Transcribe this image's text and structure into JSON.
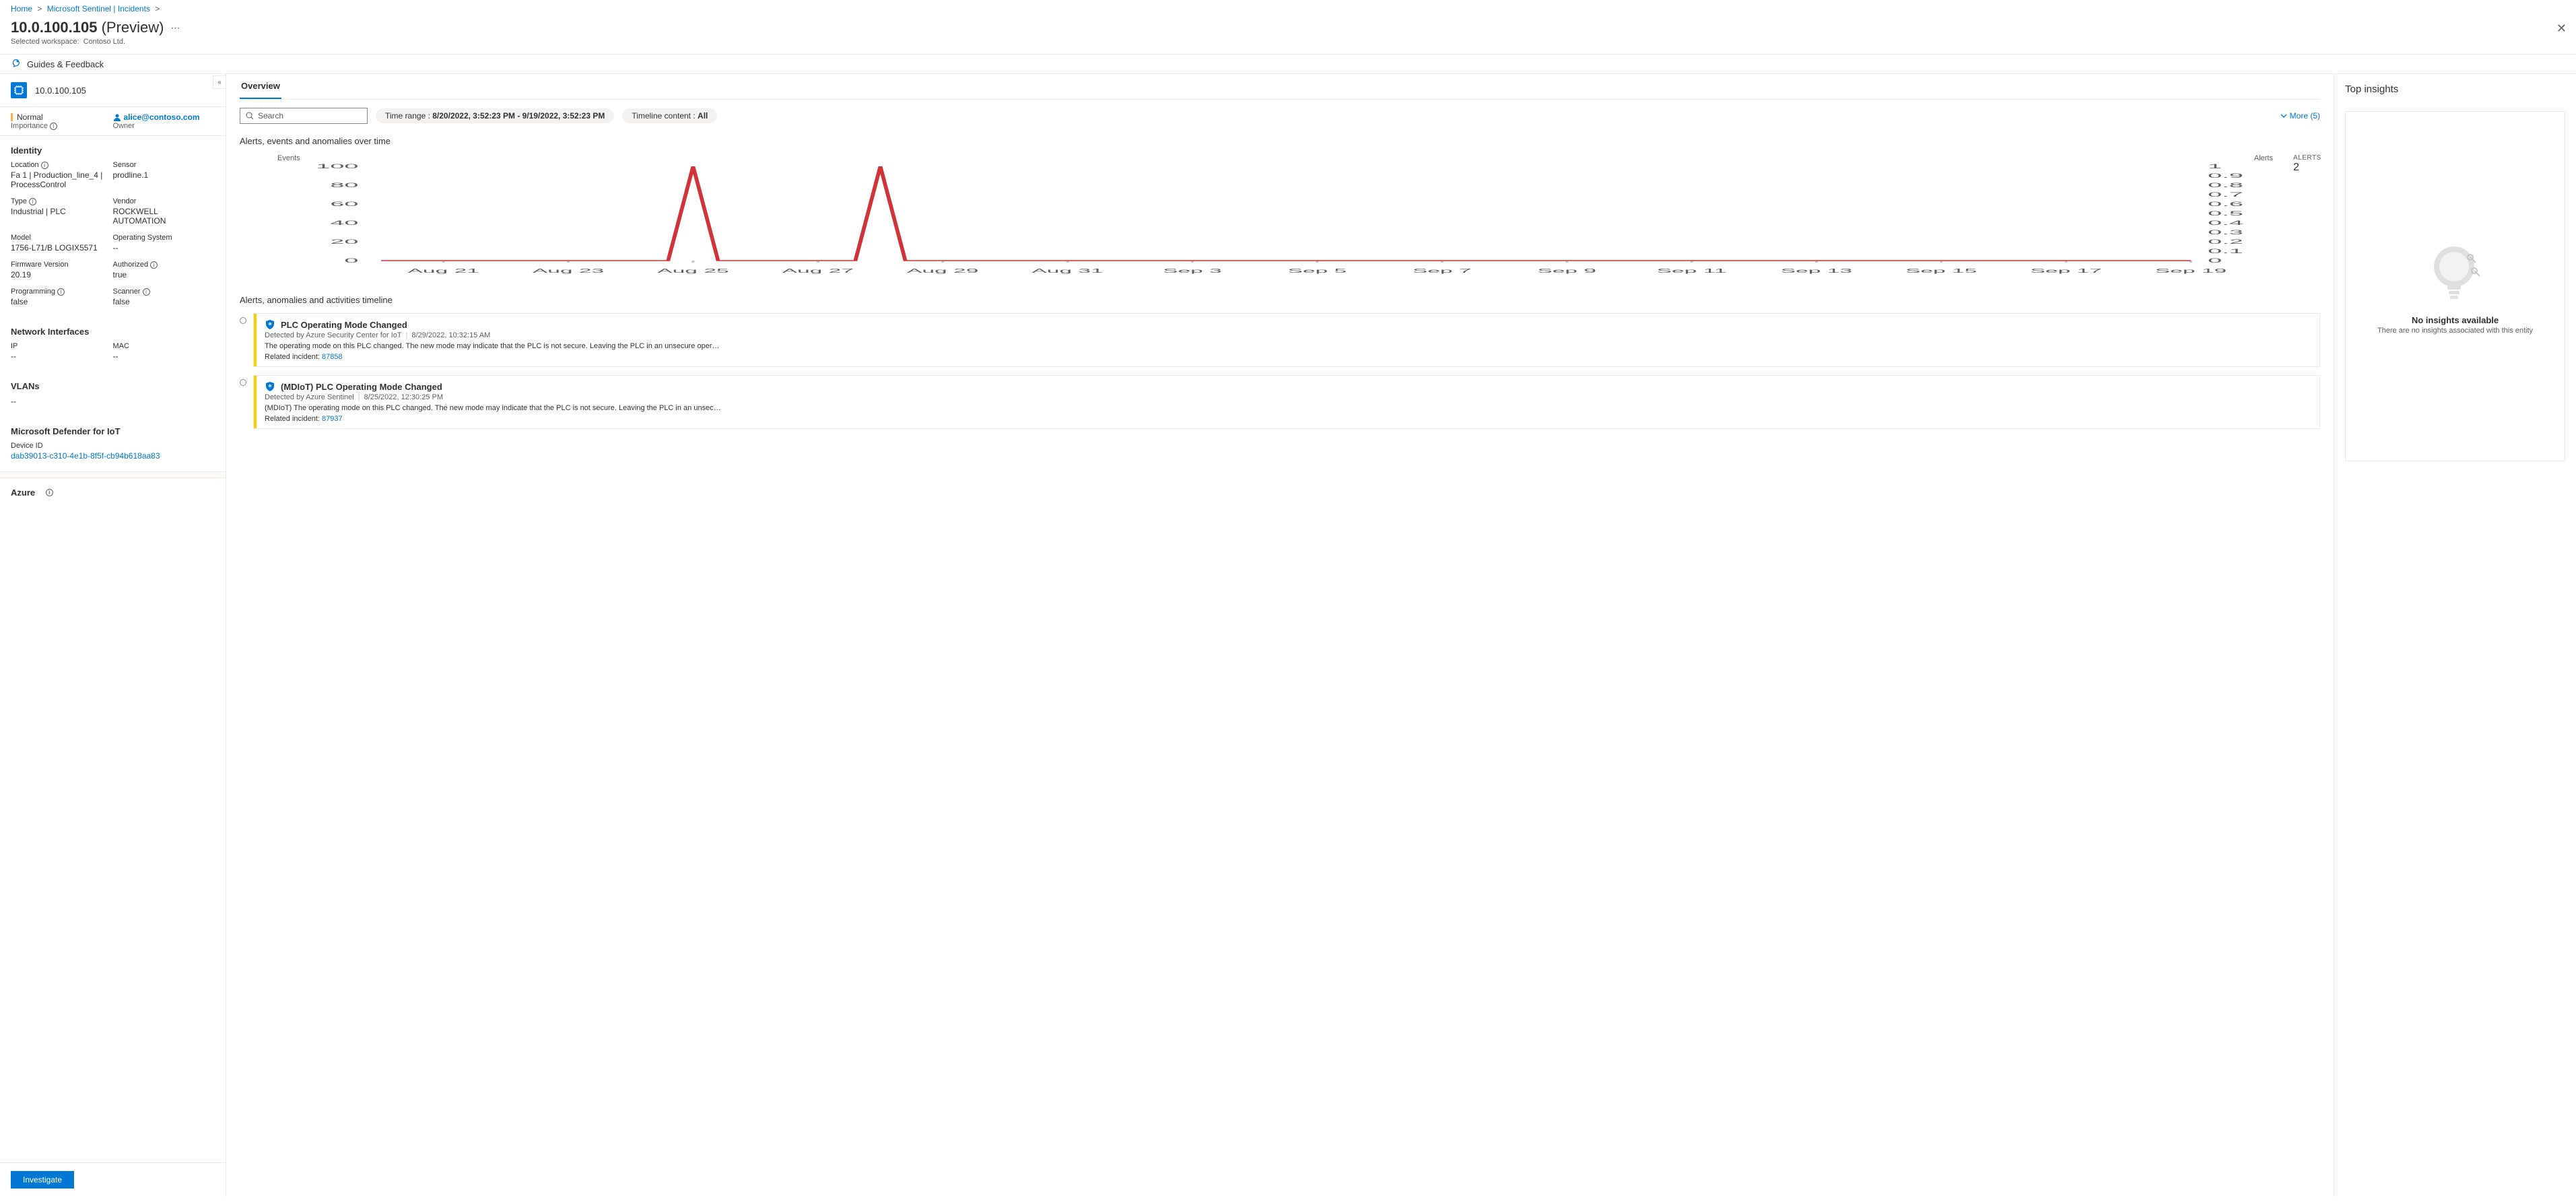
{
  "breadcrumb": {
    "home": "Home",
    "sentinel": "Microsoft Sentinel | Incidents"
  },
  "page": {
    "title": "10.0.100.105",
    "title_suffix": "(Preview)",
    "workspace_label": "Selected workspace:",
    "workspace": "Contoso Ltd."
  },
  "cmdbar": {
    "guides": "Guides & Feedback"
  },
  "entity": {
    "name": "10.0.100.105",
    "importance": "Normal",
    "importance_label": "Importance",
    "owner": "alice@contoso.com",
    "owner_label": "Owner"
  },
  "identity": {
    "title": "Identity",
    "location_label": "Location",
    "location_value": "Fa 1 | Production_line_4 | ProcessControl",
    "sensor_label": "Sensor",
    "sensor_value": "prodline.1",
    "type_label": "Type",
    "type_value": "Industrial | PLC",
    "vendor_label": "Vendor",
    "vendor_value": "ROCKWELL AUTOMATION",
    "model_label": "Model",
    "model_value": "1756-L71/B LOGIX5571",
    "os_label": "Operating System",
    "os_value": "--",
    "fw_label": "Firmware Version",
    "fw_value": "20.19",
    "auth_label": "Authorized",
    "auth_value": "true",
    "prog_label": "Programming",
    "prog_value": "false",
    "scan_label": "Scanner",
    "scan_value": "false"
  },
  "network": {
    "title": "Network Interfaces",
    "ip_label": "IP",
    "ip_value": "--",
    "mac_label": "MAC",
    "mac_value": "--"
  },
  "vlans": {
    "title": "VLANs",
    "value": "--"
  },
  "defender": {
    "title": "Microsoft Defender for IoT",
    "device_id_label": "Device ID",
    "device_id": "dab39013-c310-4e1b-8f5f-cb94b618aa83"
  },
  "azure": {
    "title": "Azure"
  },
  "investigate": "Investigate",
  "overview": {
    "tab": "Overview",
    "search_placeholder": "Search",
    "time_range_label": "Time range : ",
    "time_range_value": "8/20/2022, 3:52:23 PM - 9/19/2022, 3:52:23 PM",
    "timeline_content_label": "Timeline content : ",
    "timeline_content_value": "All",
    "more": "More (5)",
    "chart_title": "Alerts, events and anomalies over time",
    "events_axis": "Events",
    "alerts_axis": "Alerts",
    "alerts_kpi_label": "ALERTS",
    "alerts_kpi_value": "2",
    "timeline_title": "Alerts, anomalies and activities timeline"
  },
  "chart_data": {
    "type": "line",
    "categories": [
      "Aug 21",
      "Aug 23",
      "Aug 25",
      "Aug 27",
      "Aug 29",
      "Aug 31",
      "Sep 3",
      "Sep 5",
      "Sep 7",
      "Sep 9",
      "Sep 11",
      "Sep 13",
      "Sep 15",
      "Sep 17",
      "Sep 19"
    ],
    "series": [
      {
        "name": "Events",
        "values": [
          0,
          0,
          0,
          0,
          0,
          0,
          0,
          0,
          0,
          0,
          0,
          0,
          0,
          0,
          0,
          0,
          0,
          0,
          0,
          0,
          0,
          0,
          0,
          0,
          0,
          0,
          0,
          0,
          0,
          0
        ],
        "ylim": [
          0,
          100
        ],
        "ticks": [
          "0",
          "20",
          "40",
          "60",
          "80",
          "100"
        ],
        "spikes": [
          {
            "day_index": 5,
            "value": 110
          },
          {
            "day_index": 8,
            "value": 110
          }
        ],
        "color": "#d13438"
      },
      {
        "name": "Alerts",
        "values": [],
        "ylim": [
          0,
          1
        ],
        "ticks": [
          "0",
          "0.1",
          "0.2",
          "0.3",
          "0.4",
          "0.5",
          "0.6",
          "0.7",
          "0.8",
          "0.9",
          "1"
        ]
      }
    ]
  },
  "timeline": [
    {
      "title": "PLC Operating Mode Changed",
      "detected_by": "Detected by Azure Security Center for IoT",
      "time": "8/29/2022, 10:32:15 AM",
      "desc": "The operating mode on this PLC changed. The new mode may indicate that the PLC is not secure. Leaving the PLC in an unsecure operating mode may allow …",
      "related_label": "Related incident: ",
      "related_id": "87858"
    },
    {
      "title": "(MDIoT) PLC Operating Mode Changed",
      "detected_by": "Detected by Azure Sentinel",
      "time": "8/25/2022, 12:30:25 PM",
      "desc": "(MDIoT) The operating mode on this PLC changed. The new mode may indicate that the PLC is not secure. Leaving the PLC in an unsecure operating mode m…",
      "related_label": "Related incident: ",
      "related_id": "87937"
    }
  ],
  "insights": {
    "title": "Top insights",
    "none_title": "No insights available",
    "none_sub": "There are no insights associated with this entity"
  }
}
